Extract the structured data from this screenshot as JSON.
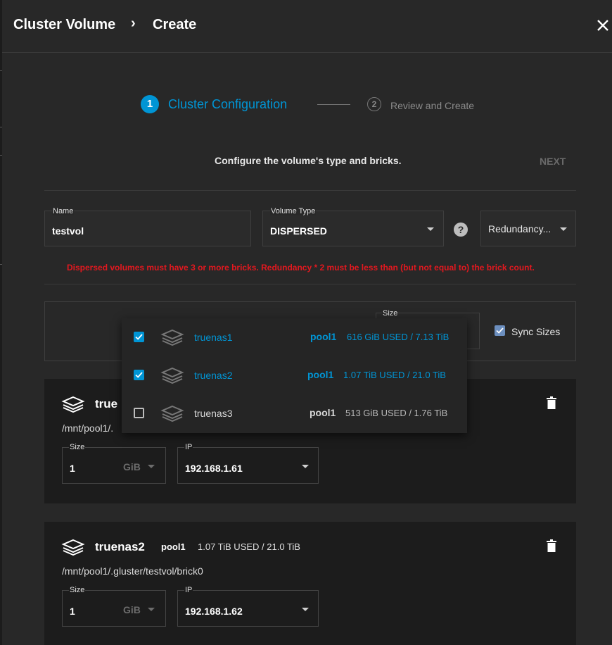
{
  "header": {
    "breadcrumb_parent": "Cluster Volume",
    "breadcrumb_separator": "›",
    "breadcrumb_current": "Create"
  },
  "stepper": {
    "step1_number": "1",
    "step1_label": "Cluster Configuration",
    "step2_number": "2",
    "step2_label": "Review and Create"
  },
  "form": {
    "description": "Configure the volume's type and bricks.",
    "next_label": "NEXT",
    "name_label": "Name",
    "name_value": "testvol",
    "volume_type_label": "Volume Type",
    "volume_type_value": "DISPERSED",
    "help_glyph": "?",
    "redundancy_value": "Redundancy...",
    "error_message": "Dispersed volumes must have 3 or more bricks. Redundancy * 2 must be less than (but not equal to) the brick count.",
    "size_label": "Size",
    "sync_sizes_label": "Sync Sizes",
    "sync_sizes_checked": true
  },
  "dropdown": {
    "items": [
      {
        "name": "truenas1",
        "pool": "pool1",
        "usage": "616 GiB USED / 7.13 TiB",
        "checked": true
      },
      {
        "name": "truenas2",
        "pool": "pool1",
        "usage": "1.07 TiB USED / 21.0 TiB",
        "checked": true
      },
      {
        "name": "truenas3",
        "pool": "pool1",
        "usage": "513 GiB USED / 1.76 TiB",
        "checked": false
      }
    ]
  },
  "bricks": [
    {
      "name": "true",
      "path": "/mnt/pool1/.",
      "size_label": "Size",
      "size_value": "1",
      "size_unit": "GiB",
      "ip_label": "IP",
      "ip_value": "192.168.1.61"
    },
    {
      "name": "truenas2",
      "pool": "pool1",
      "usage": "1.07 TiB USED / 21.0 TiB",
      "path": "/mnt/pool1/.gluster/testvol/brick0",
      "size_label": "Size",
      "size_value": "1",
      "size_unit": "GiB",
      "ip_label": "IP",
      "ip_value": "192.168.1.62"
    }
  ],
  "colors": {
    "accent": "#0095d5",
    "error": "#e3181f",
    "background": "#282828",
    "card": "#1c1c1c"
  },
  "icons": [
    "close-icon",
    "server-icon",
    "trash-icon",
    "help-icon",
    "chevron-right-icon"
  ]
}
